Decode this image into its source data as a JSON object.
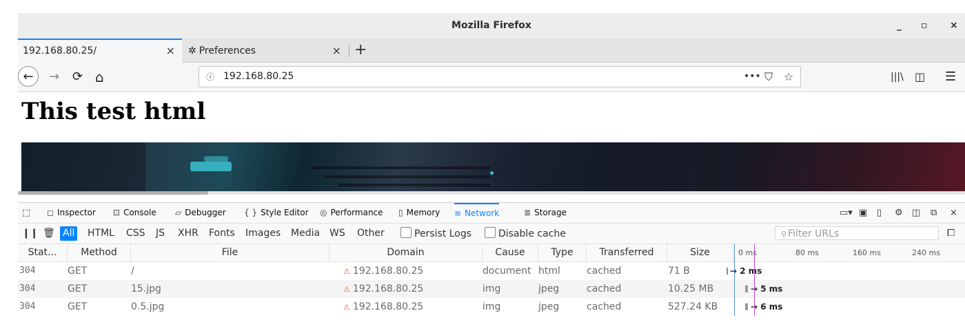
{
  "window": {
    "title": "Mozilla Firefox",
    "controls": {
      "minimize": "_",
      "maximize": "▫",
      "close": "×"
    }
  },
  "tabs": [
    {
      "label": "192.168.80.25/",
      "close": "×",
      "icon": null
    },
    {
      "label": "Preferences",
      "close": "×",
      "icon": "gear-icon"
    }
  ],
  "new_tab": "+",
  "nav": {
    "back": "←",
    "forward": "→",
    "reload": "⟳",
    "home": "⌂",
    "url": "192.168.80.25",
    "page_actions": "•••",
    "library": "|||\\",
    "sidebar": "◫",
    "menu": "☰"
  },
  "page": {
    "heading": "This test html"
  },
  "devtools": {
    "tools": [
      {
        "label": "Inspector",
        "icon": "inspector-icon"
      },
      {
        "label": "Console",
        "icon": "console-icon"
      },
      {
        "label": "Debugger",
        "icon": "debugger-icon"
      },
      {
        "label": "Style Editor",
        "icon": "style-editor-icon"
      },
      {
        "label": "Performance",
        "icon": "performance-icon"
      },
      {
        "label": "Memory",
        "icon": "memory-icon"
      },
      {
        "label": "Network",
        "icon": "network-icon",
        "selected": true
      },
      {
        "label": "Storage",
        "icon": "storage-icon"
      }
    ],
    "filters": [
      "All",
      "HTML",
      "CSS",
      "JS",
      "XHR",
      "Fonts",
      "Images",
      "Media",
      "WS",
      "Other"
    ],
    "selected_filter": "All",
    "persist_logs": "Persist Logs",
    "disable_cache": "Disable cache",
    "filter_placeholder": "Filter URLs",
    "columns": [
      "Stat...",
      "Method",
      "File",
      "Domain",
      "Cause",
      "Type",
      "Transferred",
      "Size"
    ],
    "timeline_labels": [
      "0 ms",
      "80 ms",
      "160 ms",
      "240 ms"
    ],
    "rows": [
      {
        "status": "304",
        "method": "GET",
        "file": "/",
        "domain": "192.168.80.25",
        "cause": "document",
        "type": "html",
        "transferred": "cached",
        "size": "71 B",
        "time": "→ 2 ms"
      },
      {
        "status": "304",
        "method": "GET",
        "file": "15.jpg",
        "domain": "192.168.80.25",
        "cause": "img",
        "type": "jpeg",
        "transferred": "cached",
        "size": "10.25 MB",
        "time": "→ 5 ms"
      },
      {
        "status": "304",
        "method": "GET",
        "file": "0.5.jpg",
        "domain": "192.168.80.25",
        "cause": "img",
        "type": "jpeg",
        "transferred": "cached",
        "size": "527.24 KB",
        "time": "→ 6 ms"
      }
    ]
  }
}
